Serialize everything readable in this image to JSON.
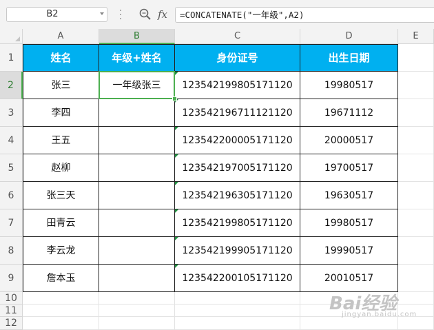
{
  "formula_bar": {
    "name_box": "B2",
    "fx_label": "fx",
    "formula": "=CONCATENATE(\"一年级\",A2)"
  },
  "columns": [
    "A",
    "B",
    "C",
    "D",
    "E"
  ],
  "rows": [
    "1",
    "2",
    "3",
    "4",
    "5",
    "6",
    "7",
    "8",
    "9",
    "10",
    "11",
    "12"
  ],
  "table": {
    "headers": [
      "姓名",
      "年级+姓名",
      "身份证号",
      "出生日期"
    ],
    "rows": [
      [
        "张三",
        "一年级张三",
        "123542199805171120",
        "19980517"
      ],
      [
        "李四",
        "",
        "123542196711121120",
        "19671112"
      ],
      [
        "王五",
        "",
        "123542200005171120",
        "20000517"
      ],
      [
        "赵柳",
        "",
        "123542197005171120",
        "19700517"
      ],
      [
        "张三天",
        "",
        "123542196305171120",
        "19630517"
      ],
      [
        "田青云",
        "",
        "123542199805171120",
        "19980517"
      ],
      [
        "李云龙",
        "",
        "123542199905171120",
        "19990517"
      ],
      [
        "詹本玉",
        "",
        "123542200105171120",
        "20010517"
      ]
    ]
  },
  "selection": {
    "cell": "B2",
    "column": "B",
    "row": "2"
  },
  "colors": {
    "header_fill": "#00b0f0",
    "selection": "#4caf50",
    "error_indicator": "#1e8e3e"
  },
  "watermark": {
    "logo": "Bai经验",
    "sub": "jingyan.baidu.com"
  }
}
